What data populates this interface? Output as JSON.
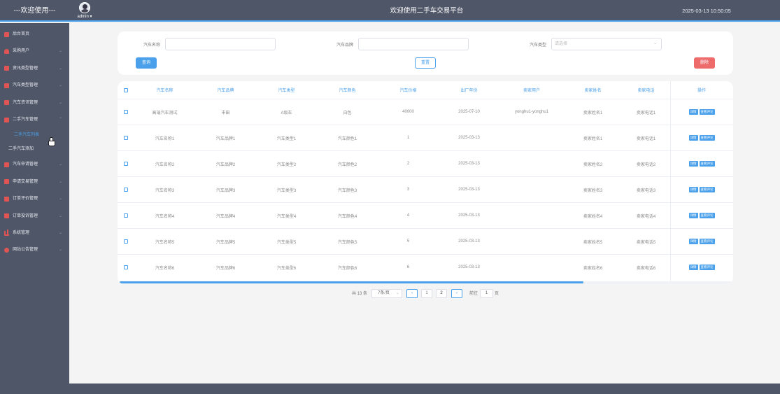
{
  "header": {
    "welcome": "---欢迎使用---",
    "user": "admin ▾",
    "platform_title": "欢迎使用二手车交易平台",
    "datetime": "2025-03-13 10:50:05"
  },
  "sidebar": {
    "items": [
      {
        "label": "后台首页",
        "icon": "monitor-icon"
      },
      {
        "label": "采购用户",
        "icon": "person-icon",
        "arrow": "⌄"
      },
      {
        "label": "资讯类型管理",
        "icon": "square-icon",
        "arrow": "⌄"
      },
      {
        "label": "汽车类型管理",
        "icon": "square-icon",
        "arrow": "⌄"
      },
      {
        "label": "汽车资讯管理",
        "icon": "square-icon",
        "arrow": "⌄"
      },
      {
        "label": "二手汽车管理",
        "icon": "square-icon",
        "arrow": "⌃"
      }
    ],
    "submenu": [
      {
        "label": "二手汽车列表",
        "active": true
      },
      {
        "label": "二手汽车添加",
        "active": false
      }
    ],
    "items2": [
      {
        "label": "汽车申请管理",
        "icon": "square-icon",
        "arrow": "⌄"
      },
      {
        "label": "申请交易管理",
        "icon": "square-icon",
        "arrow": "⌄"
      },
      {
        "label": "订单评价管理",
        "icon": "square-icon",
        "arrow": "⌄"
      },
      {
        "label": "订单投诉管理",
        "icon": "square-icon",
        "arrow": "⌄"
      },
      {
        "label": "系统管理",
        "icon": "bar-chart-icon",
        "arrow": "⌄"
      },
      {
        "label": "网站公告管理",
        "icon": "circle-icon",
        "arrow": "⌄"
      }
    ]
  },
  "search": {
    "name_label": "汽车名称",
    "name_value": "",
    "brand_label": "汽车品牌",
    "brand_value": "",
    "type_label": "汽车类型",
    "type_placeholder": "请选择",
    "query_label": "查询",
    "reset_label": "重置",
    "delete_label": "删除"
  },
  "table": {
    "columns": [
      "汽车名称",
      "汽车品牌",
      "汽车类型",
      "汽车颜色",
      "汽车价格",
      "出厂年份",
      "卖家用户",
      "卖家姓名",
      "卖家电话",
      "操作"
    ],
    "rows": [
      [
        "高端汽车测试",
        "丰田",
        "A级车",
        "白色",
        "40000",
        "2025-07-10",
        "yonghu1-yonghu1",
        "卖家姓名1",
        "卖家电话1"
      ],
      [
        "汽车名称1",
        "汽车品牌1",
        "汽车类型1",
        "汽车颜色1",
        "1",
        "2025-03-13",
        "",
        "卖家姓名1",
        "卖家电话1"
      ],
      [
        "汽车名称2",
        "汽车品牌2",
        "汽车类型2",
        "汽车颜色2",
        "2",
        "2025-03-13",
        "",
        "卖家姓名2",
        "卖家电话2"
      ],
      [
        "汽车名称3",
        "汽车品牌3",
        "汽车类型3",
        "汽车颜色3",
        "3",
        "2025-03-13",
        "",
        "卖家姓名3",
        "卖家电话3"
      ],
      [
        "汽车名称4",
        "汽车品牌4",
        "汽车类型4",
        "汽车颜色4",
        "4",
        "2025-03-13",
        "",
        "卖家姓名4",
        "卖家电话4"
      ],
      [
        "汽车名称5",
        "汽车品牌5",
        "汽车类型5",
        "汽车颜色5",
        "5",
        "2025-03-13",
        "",
        "卖家姓名5",
        "卖家电话5"
      ],
      [
        "汽车名称6",
        "汽车品牌6",
        "汽车类型6",
        "汽车颜色6",
        "6",
        "2025-03-13",
        "",
        "卖家姓名6",
        "卖家电话6"
      ]
    ],
    "detail_label": "详情",
    "review_label": "查看评论"
  },
  "pager": {
    "total": "共 13 条",
    "page_size": "7条/页",
    "size_arrow": "⌄",
    "prev": "‹",
    "next": "›",
    "pages": [
      "1",
      "2"
    ],
    "goto_label": "前往",
    "goto_value": "1",
    "page_unit": "页"
  },
  "colors": {
    "sidebar_bg": "#4f5668",
    "accent": "#4aa0ea",
    "danger": "#ee6b6b"
  }
}
